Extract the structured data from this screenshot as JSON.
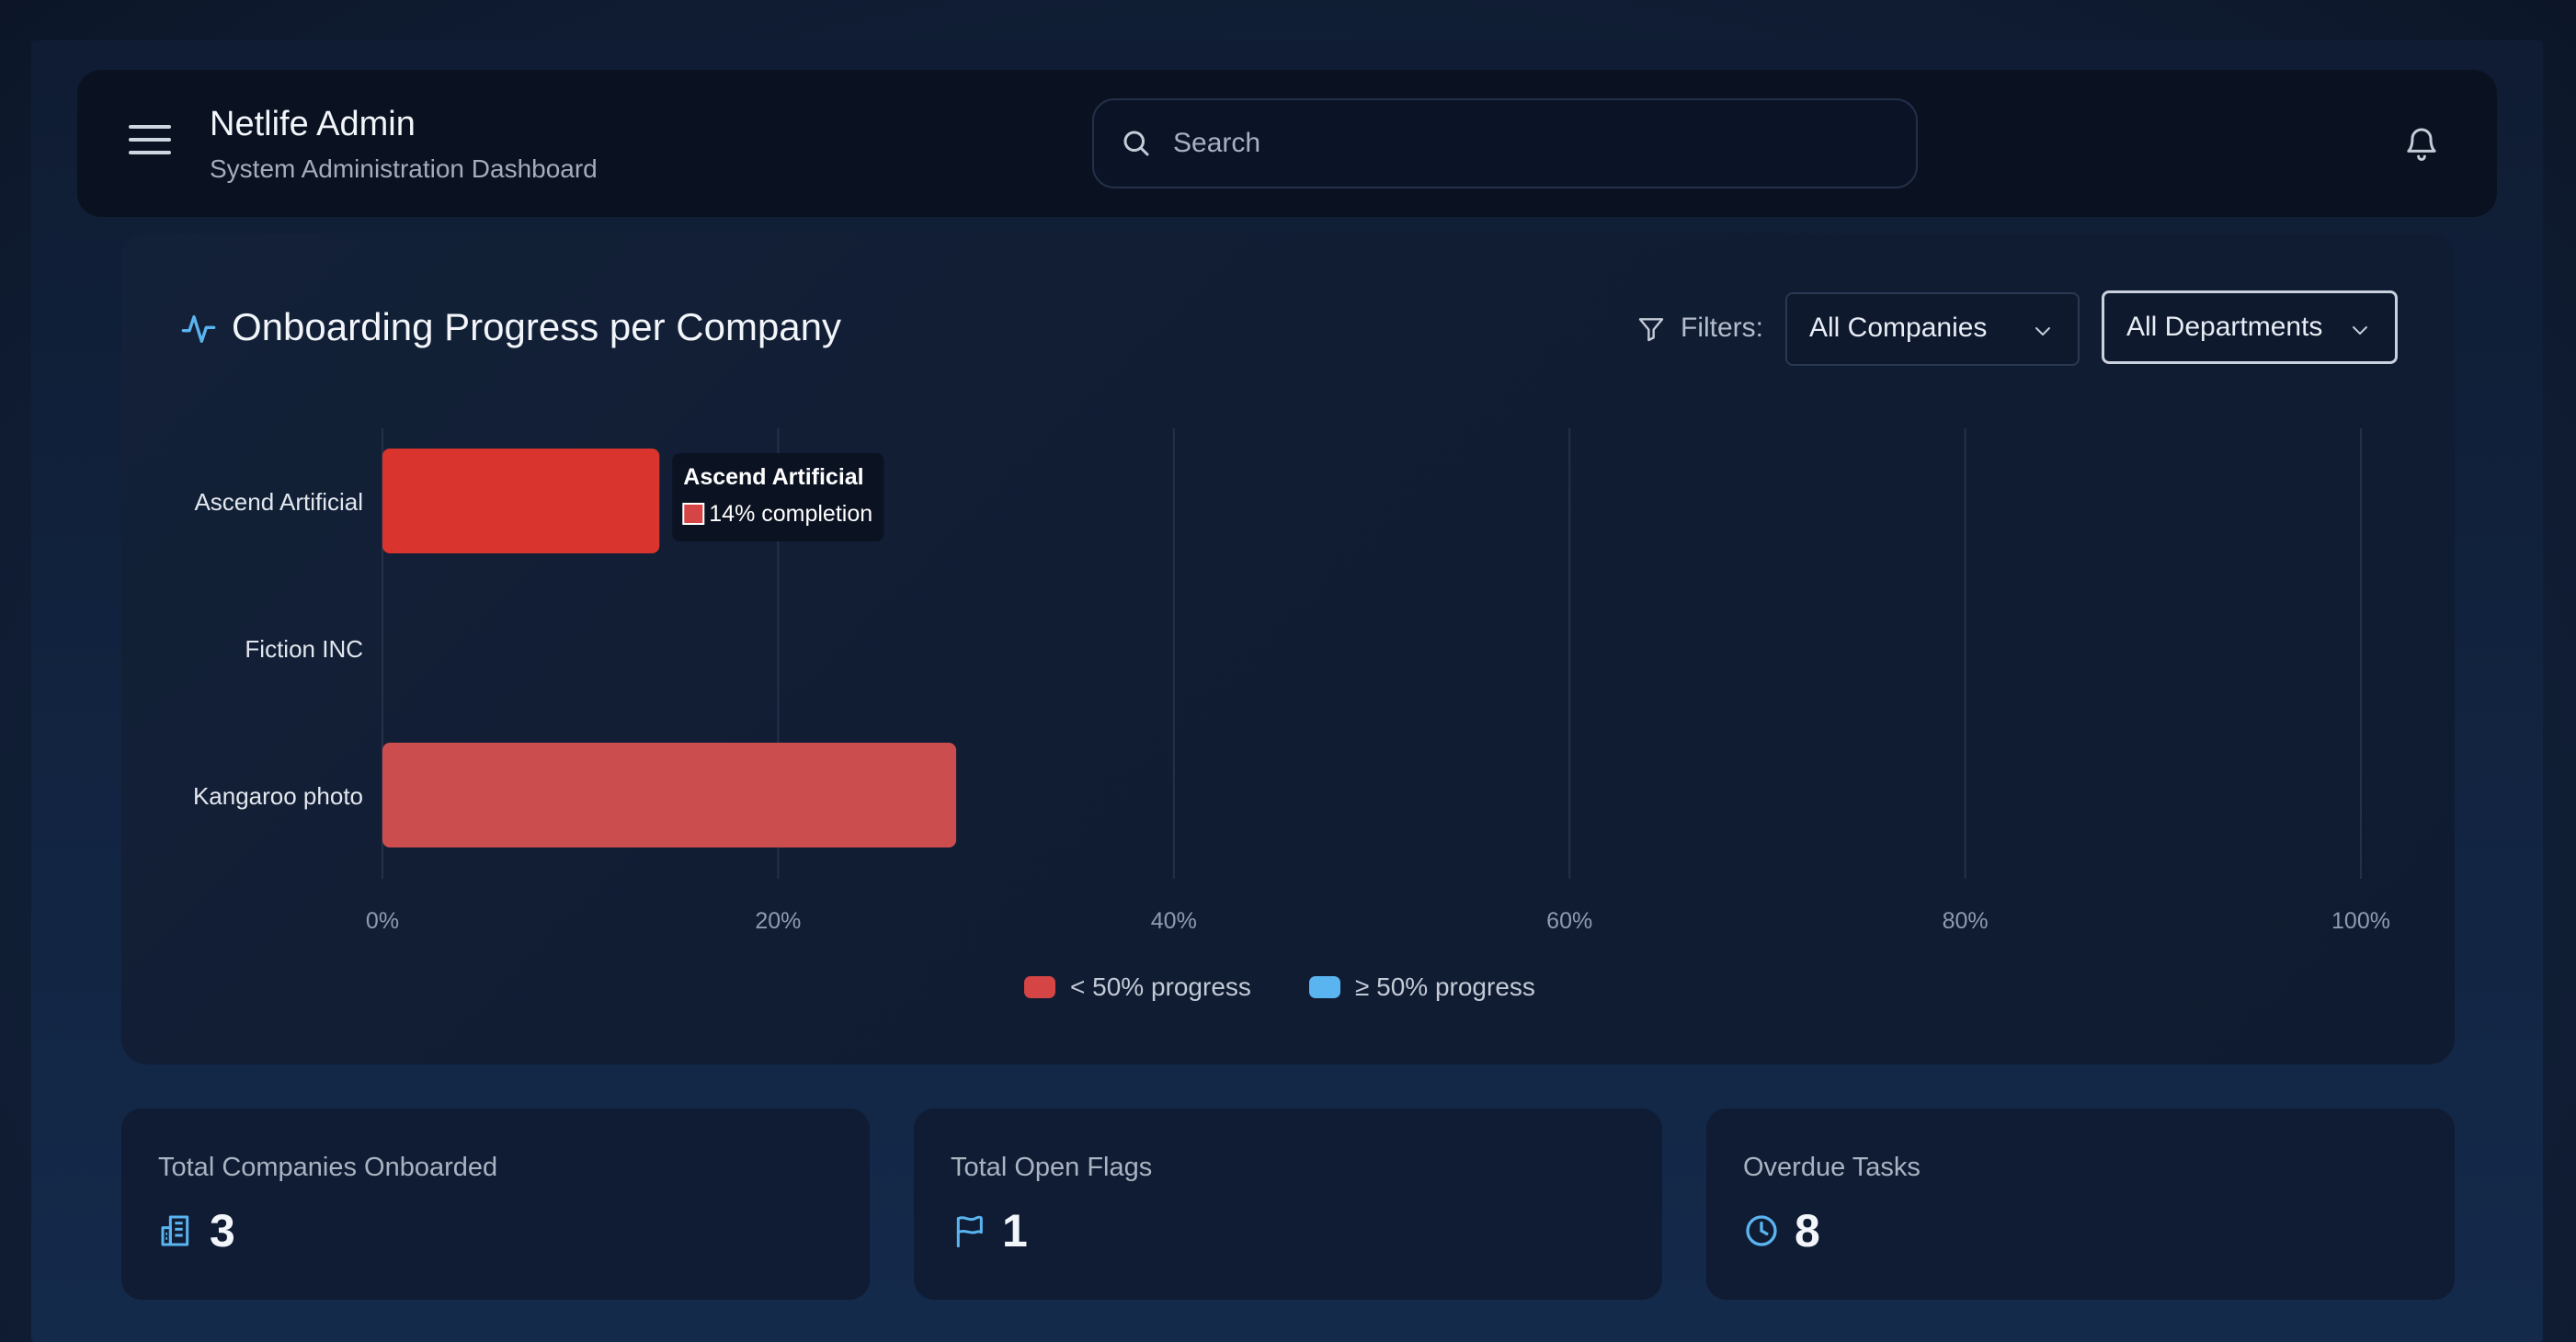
{
  "header": {
    "title": "Netlife Admin",
    "subtitle": "System Administration Dashboard",
    "search_placeholder": "Search"
  },
  "chart_card": {
    "title": "Onboarding Progress per Company",
    "filters_label": "Filters:",
    "company_filter": "All Companies",
    "department_filter": "All Departments"
  },
  "chart_data": {
    "type": "bar",
    "orientation": "horizontal",
    "categories": [
      "Ascend Artificial",
      "Fiction INC",
      "Kangaroo photo"
    ],
    "values": [
      14,
      0,
      29
    ],
    "value_unit": "%",
    "xlim": [
      0,
      100
    ],
    "x_ticks": [
      "0%",
      "20%",
      "40%",
      "60%",
      "80%",
      "100%"
    ],
    "x_tick_values": [
      0,
      20,
      40,
      60,
      80,
      100
    ],
    "grid": true,
    "legend_position": "bottom",
    "legend": [
      {
        "label": "< 50% progress",
        "color": "#d64545"
      },
      {
        "label": "≥ 50% progress",
        "color": "#5ab4f0"
      }
    ],
    "tooltip": {
      "category_index": 0,
      "title": "Ascend Artificial",
      "text": "14% completion"
    },
    "bar_colors": [
      "#d9352e",
      "#d64545",
      "#cc4d4d"
    ]
  },
  "stats": [
    {
      "label": "Total Companies Onboarded",
      "value": "3",
      "icon": "building-icon"
    },
    {
      "label": "Total Open Flags",
      "value": "1",
      "icon": "flag-icon"
    },
    {
      "label": "Overdue Tasks",
      "value": "8",
      "icon": "clock-icon"
    }
  ],
  "colors": {
    "accent": "#5ab4f0",
    "low_progress": "#d64545",
    "background": "#0c1628"
  }
}
